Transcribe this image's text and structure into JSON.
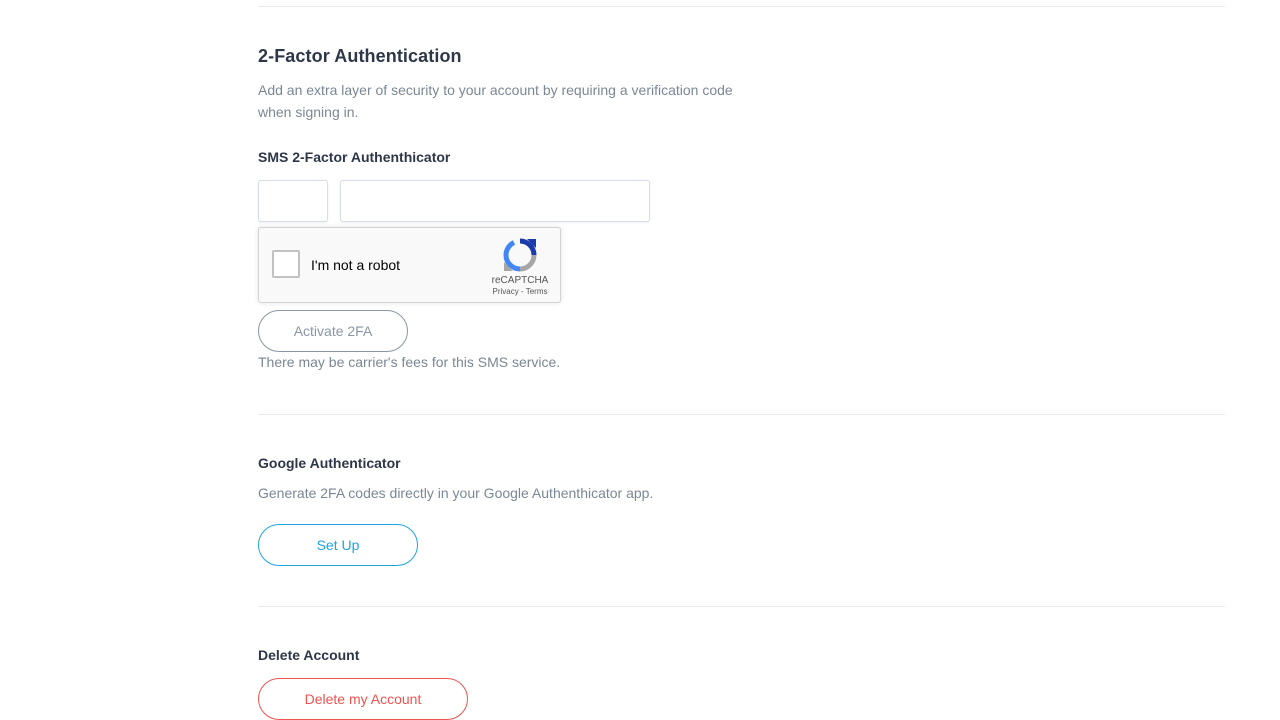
{
  "twofa": {
    "title": "2-Factor Authentication",
    "description": "Add an extra layer of security to your account by requiring a verification code when signing in.",
    "sms": {
      "title": "SMS 2-Factor Authenthicator",
      "country_code_value": "",
      "phone_value": "",
      "activate_label": "Activate 2FA",
      "fees_note": "There may be carrier's fees for this SMS service."
    },
    "captcha": {
      "label": "I'm not a robot",
      "brand": "reCAPTCHA",
      "links": "Privacy - Terms",
      "checked": false
    }
  },
  "google_auth": {
    "title": "Google Authenticator",
    "description": "Generate 2FA codes directly in your Google Authenthicator app.",
    "setup_label": "Set Up"
  },
  "delete_account": {
    "title": "Delete Account",
    "button_label": "Delete my Account"
  },
  "colors": {
    "heading": "#2d3748",
    "muted": "#7b8794",
    "accent_blue": "#1ea3e3",
    "danger_red": "#ef5350"
  }
}
